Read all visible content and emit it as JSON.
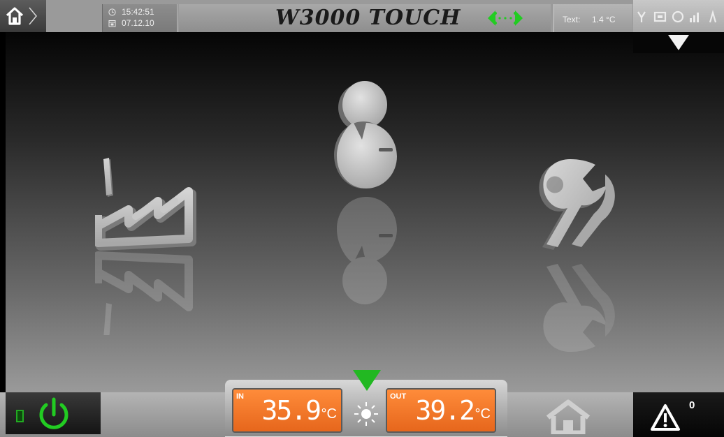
{
  "header": {
    "time": "15:42:51",
    "date": "07.12.10",
    "title": "W3000 TOUCH",
    "external_temp_label": "Text:",
    "external_temp_value": "1.4 °C"
  },
  "status_icons": [
    "signal-icon",
    "compressor-icon",
    "pump-icon",
    "chart-icon"
  ],
  "menu": {
    "items": [
      {
        "name": "plant-menu",
        "icon": "factory-icon"
      },
      {
        "name": "user-menu",
        "icon": "user-icon"
      },
      {
        "name": "service-menu",
        "icon": "wrench-icon"
      }
    ]
  },
  "bottom": {
    "temp_in_label": "IN",
    "temp_in_value": "35.9",
    "temp_out_label": "OUT",
    "temp_out_value": "39.2",
    "temp_unit": "°C",
    "mode_icon": "sun-icon",
    "alarm_count": "0"
  },
  "colors": {
    "link_green": "#22cc22",
    "temp_orange": "#f07a2a",
    "power_green": "#22cc22",
    "mode_indicator_green": "#22b822"
  }
}
